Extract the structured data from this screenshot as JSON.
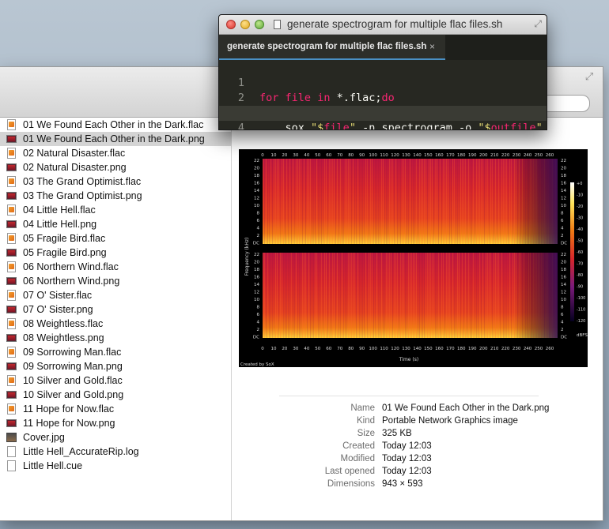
{
  "finder": {
    "files": [
      {
        "name": "01 We Found Each Other in the Dark.flac",
        "type": "flac",
        "selected": false
      },
      {
        "name": "01 We Found Each Other in the Dark.png",
        "type": "png",
        "selected": true
      },
      {
        "name": "02 Natural Disaster.flac",
        "type": "flac",
        "selected": false
      },
      {
        "name": "02 Natural Disaster.png",
        "type": "png",
        "selected": false
      },
      {
        "name": "03 The Grand Optimist.flac",
        "type": "flac",
        "selected": false
      },
      {
        "name": "03 The Grand Optimist.png",
        "type": "png",
        "selected": false
      },
      {
        "name": "04 Little Hell.flac",
        "type": "flac",
        "selected": false
      },
      {
        "name": "04 Little Hell.png",
        "type": "png",
        "selected": false
      },
      {
        "name": "05 Fragile Bird.flac",
        "type": "flac",
        "selected": false
      },
      {
        "name": "05 Fragile Bird.png",
        "type": "png",
        "selected": false
      },
      {
        "name": "06 Northern Wind.flac",
        "type": "flac",
        "selected": false
      },
      {
        "name": "06 Northern Wind.png",
        "type": "png",
        "selected": false
      },
      {
        "name": "07 O' Sister.flac",
        "type": "flac",
        "selected": false
      },
      {
        "name": "07 O' Sister.png",
        "type": "png",
        "selected": false
      },
      {
        "name": "08 Weightless.flac",
        "type": "flac",
        "selected": false
      },
      {
        "name": "08 Weightless.png",
        "type": "png",
        "selected": false
      },
      {
        "name": "09 Sorrowing Man.flac",
        "type": "flac",
        "selected": false
      },
      {
        "name": "09 Sorrowing Man.png",
        "type": "png",
        "selected": false
      },
      {
        "name": "10 Silver and Gold.flac",
        "type": "flac",
        "selected": false
      },
      {
        "name": "10 Silver and Gold.png",
        "type": "png",
        "selected": false
      },
      {
        "name": "11 Hope for Now.flac",
        "type": "flac",
        "selected": false
      },
      {
        "name": "11 Hope for Now.png",
        "type": "png",
        "selected": false
      },
      {
        "name": "Cover.jpg",
        "type": "jpg",
        "selected": false
      },
      {
        "name": "Little Hell_AccurateRip.log",
        "type": "doc",
        "selected": false
      },
      {
        "name": "Little Hell.cue",
        "type": "doc",
        "selected": false
      }
    ],
    "info": [
      {
        "label": "Name",
        "value": "01 We Found Each Other in the Dark.png"
      },
      {
        "label": "Kind",
        "value": "Portable Network Graphics image"
      },
      {
        "label": "Size",
        "value": "325 KB"
      },
      {
        "label": "Created",
        "value": "Today 12:03"
      },
      {
        "label": "Modified",
        "value": "Today 12:03"
      },
      {
        "label": "Last opened",
        "value": "Today 12:03"
      },
      {
        "label": "Dimensions",
        "value": "943 × 593"
      }
    ],
    "preview": {
      "ylabel": "Frequency (kHz)",
      "xlabel": "Time (s)",
      "credit": "Created by SoX",
      "yticks": [
        "22",
        "20",
        "18",
        "16",
        "14",
        "12",
        "10",
        "8",
        "6",
        "4",
        "2",
        "DC"
      ],
      "xticks": [
        "0",
        "10",
        "20",
        "30",
        "40",
        "50",
        "60",
        "70",
        "80",
        "90",
        "100",
        "110",
        "120",
        "130",
        "140",
        "150",
        "160",
        "170",
        "180",
        "190",
        "200",
        "210",
        "220",
        "230",
        "240",
        "250",
        "260"
      ],
      "colorbar_ticks": [
        "+0",
        "-10",
        "-20",
        "-30",
        "-40",
        "-50",
        "-60",
        "-70",
        "-80",
        "-90",
        "-100",
        "-110",
        "-120"
      ],
      "colorbar_unit": "dBFS"
    }
  },
  "editor": {
    "title": "generate spectrogram for multiple flac files.sh",
    "tab_label": "generate spectrogram for multiple flac files.sh",
    "tab_close": "×",
    "line_numbers": [
      "1",
      "2",
      "3",
      "4"
    ]
  },
  "colors": {
    "editor_bg": "#272822",
    "keyword": "#f92672",
    "string": "#e6db74",
    "tab_accent": "#4a90c4",
    "selection_row": "#d4d4d4"
  }
}
